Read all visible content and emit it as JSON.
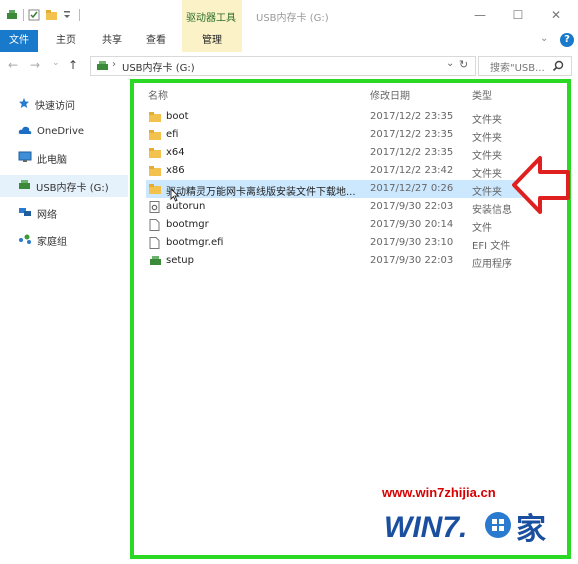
{
  "titlebar": {
    "context_tab": "驱动器工具",
    "title": "USB内存卡 (G:)",
    "minimize": "—",
    "maximize": "☐",
    "close": "✕"
  },
  "ribbon": {
    "tabs": [
      "文件",
      "主页",
      "共享",
      "查看",
      "管理"
    ],
    "help": "?",
    "expand": "⌄"
  },
  "address": {
    "back": "←",
    "forward": "→",
    "recent": "⌄",
    "up": "↑",
    "path": "USB内存卡 (G:)",
    "separator": "›",
    "dropdown": "⌄",
    "refresh": "↻",
    "search_placeholder": "搜索\"USB...",
    "search_icon": "search-icon"
  },
  "nav": {
    "items": [
      {
        "label": "快速访问",
        "icon": "star-icon"
      },
      {
        "label": "OneDrive",
        "icon": "cloud-icon"
      },
      {
        "label": "此电脑",
        "icon": "computer-icon"
      },
      {
        "label": "USB内存卡 (G:)",
        "icon": "usb-drive-icon"
      },
      {
        "label": "网络",
        "icon": "network-icon"
      },
      {
        "label": "家庭组",
        "icon": "homegroup-icon"
      }
    ]
  },
  "files": {
    "columns": [
      "名称",
      "修改日期",
      "类型"
    ],
    "rows": [
      {
        "name": "boot",
        "date": "2017/12/2 23:35",
        "type": "文件夹",
        "icon": "folder-icon"
      },
      {
        "name": "efi",
        "date": "2017/12/2 23:35",
        "type": "文件夹",
        "icon": "folder-icon"
      },
      {
        "name": "x64",
        "date": "2017/12/2 23:35",
        "type": "文件夹",
        "icon": "folder-icon"
      },
      {
        "name": "x86",
        "date": "2017/12/2 23:42",
        "type": "文件夹",
        "icon": "folder-icon"
      },
      {
        "name": "驱动精灵万能网卡离线版安装文件下载地...",
        "date": "2017/12/27 0:26",
        "type": "文件夹",
        "icon": "folder-icon"
      },
      {
        "name": "autorun",
        "date": "2017/9/30 22:03",
        "type": "安装信息",
        "icon": "settings-file-icon"
      },
      {
        "name": "bootmgr",
        "date": "2017/9/30 20:14",
        "type": "文件",
        "icon": "file-icon"
      },
      {
        "name": "bootmgr.efi",
        "date": "2017/9/30 23:10",
        "type": "EFI 文件",
        "icon": "file-icon"
      },
      {
        "name": "setup",
        "date": "2017/9/30 22:03",
        "type": "应用程序",
        "icon": "app-icon"
      }
    ]
  },
  "watermark": {
    "url": "www.win7zhijia.cn",
    "logo": "WIN7.之家"
  },
  "colors": {
    "accent": "#1979ca",
    "context_tab": "#fbf2c8",
    "highlight_frame": "#2bd823",
    "arrow": "#e02020",
    "folder": "#f2c14e"
  }
}
